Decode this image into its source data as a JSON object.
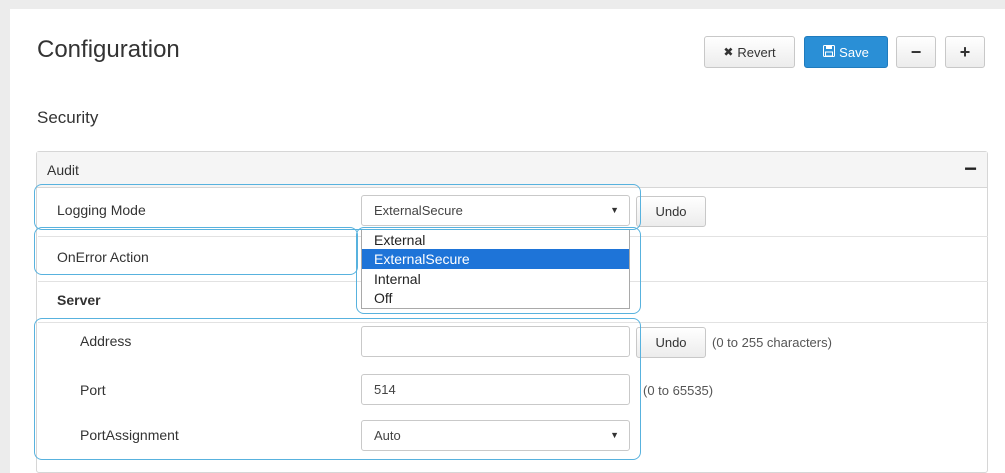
{
  "header": {
    "title": "Configuration",
    "revert_label": "Revert",
    "save_label": "Save",
    "minus_label": "−",
    "plus_label": "+"
  },
  "section": {
    "title": "Security"
  },
  "panel": {
    "title": "Audit",
    "collapse_label": "−",
    "rows": {
      "logging_mode": {
        "label": "Logging Mode",
        "value": "ExternalSecure",
        "undo_label": "Undo"
      },
      "onerror_action": {
        "label": "OnError Action"
      },
      "server": {
        "label": "Server"
      },
      "address": {
        "label": "Address",
        "value": "",
        "undo_label": "Undo",
        "hint": "(0 to 255 characters)"
      },
      "port": {
        "label": "Port",
        "value": "514",
        "hint": "(0 to 65535)"
      },
      "port_assignment": {
        "label": "PortAssignment",
        "value": "Auto"
      }
    }
  },
  "dropdown": {
    "options": [
      "External",
      "ExternalSecure",
      "Internal",
      "Off"
    ],
    "selected": "ExternalSecure"
  },
  "colors": {
    "accent": "#2a8fd6",
    "highlight": "#58b2de",
    "selection": "#1e74d8"
  }
}
